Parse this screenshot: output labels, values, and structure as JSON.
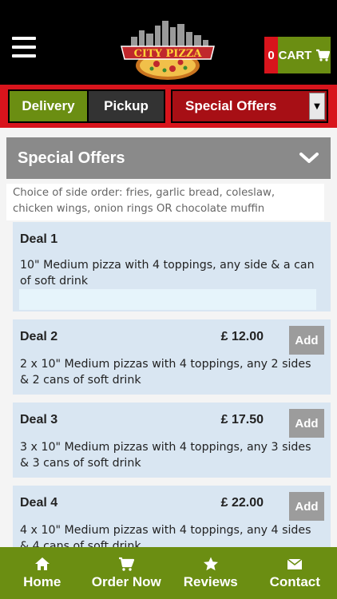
{
  "header": {
    "logo_text": "CITY PIZZA",
    "cart_count": "0",
    "cart_label": "CART"
  },
  "tabs": {
    "delivery": "Delivery",
    "pickup": "Pickup",
    "select_value": "Special Offers"
  },
  "section": {
    "title": "Special Offers",
    "note": "Choice of side order: fries, garlic bread, coleslaw, chicken wings, onion rings OR chocolate muffin"
  },
  "deals": [
    {
      "name": "Deal 1",
      "price": "",
      "add": "",
      "desc": "10\" Medium pizza with 4 toppings, any side & a can of soft drink"
    },
    {
      "name": "Deal 2",
      "price": "£ 12.00",
      "add": "Add",
      "desc": "2 x 10\" Medium pizzas with 4 toppings, any 2 sides & 2 cans of soft drink"
    },
    {
      "name": "Deal 3",
      "price": "£ 17.50",
      "add": "Add",
      "desc": "3 x 10\" Medium pizzas with 4 toppings, any 3 sides & 3 cans of soft drink"
    },
    {
      "name": "Deal 4",
      "price": "£ 22.00",
      "add": "Add",
      "desc": "4 x 10\" Medium pizzas with 4 toppings, any 4 sides & 4 cans of soft drink"
    }
  ],
  "nav": {
    "home": "Home",
    "order": "Order Now",
    "reviews": "Reviews",
    "contact": "Contact"
  },
  "colors": {
    "header_bg": "#000000",
    "brand_red": "#d8141c",
    "brand_green": "#6b8e12",
    "deal_bg": "#d9e6f2"
  }
}
